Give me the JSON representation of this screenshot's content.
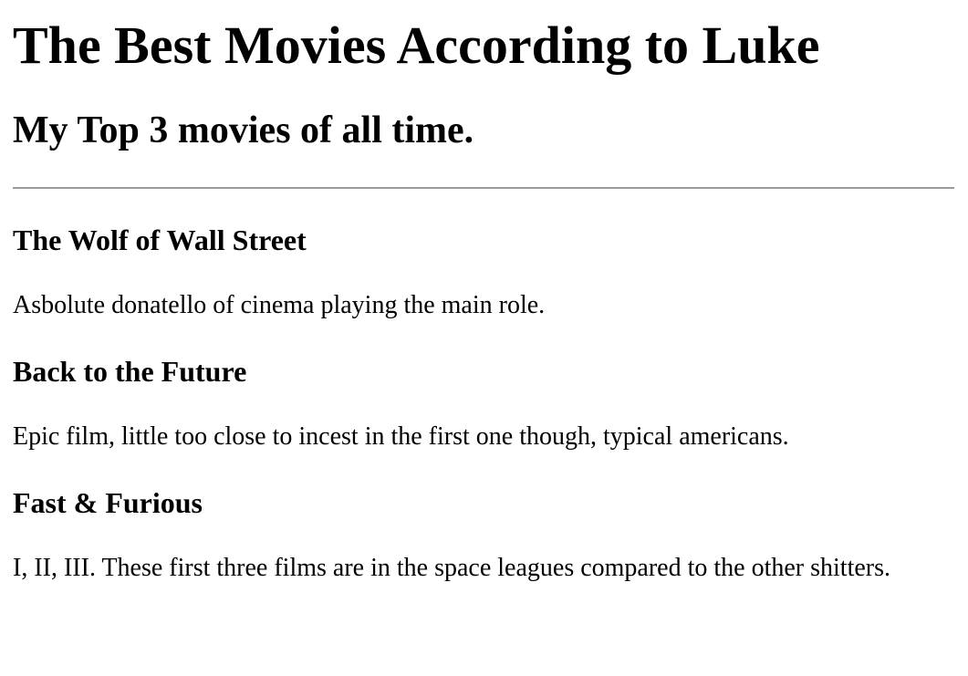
{
  "header": {
    "title": "The Best Movies According to Luke",
    "subtitle": "My Top 3 movies of all time."
  },
  "movies": [
    {
      "title": "The Wolf of Wall Street",
      "description": "Asbolute donatello of cinema playing the main role."
    },
    {
      "title": "Back to the Future",
      "description": "Epic film, little too close to incest in the first one though, typical americans."
    },
    {
      "title": "Fast & Furious",
      "description": "I, II, III. These first three films are in the space leagues compared to the other shitters."
    }
  ]
}
